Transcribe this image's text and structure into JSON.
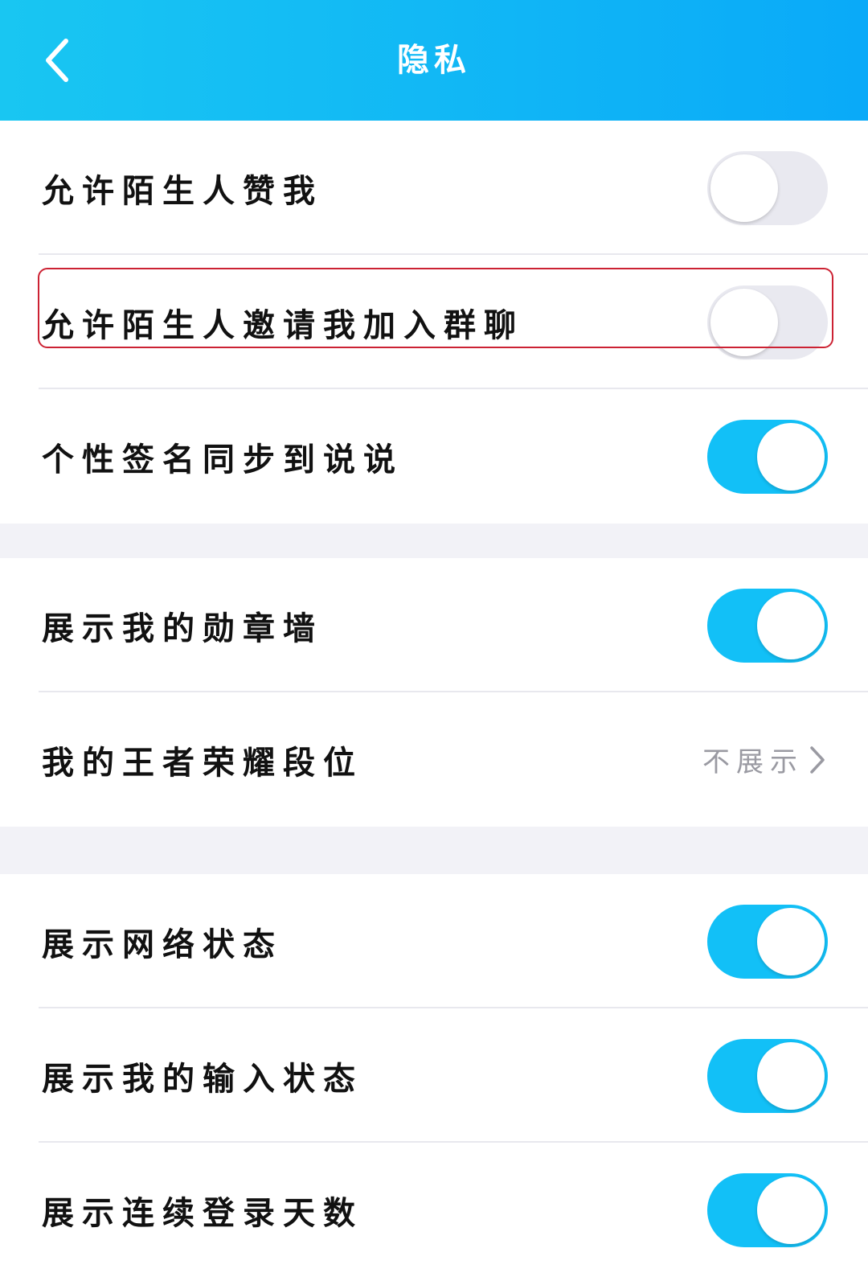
{
  "header": {
    "title": "隐私",
    "back_icon": "chevron-left-icon"
  },
  "colors": {
    "header_gradient_start": "#19c6f2",
    "header_gradient_end": "#0aaaf8",
    "toggle_on": "#12c0f7",
    "toggle_off": "#e9e9f0",
    "highlight": "#cc2233"
  },
  "sections": [
    {
      "rows": [
        {
          "label": "允许陌生人赞我",
          "toggle": false
        },
        {
          "label": "允许陌生人邀请我加入群聊",
          "toggle": false
        },
        {
          "label": "个性签名同步到说说",
          "toggle": true
        }
      ]
    },
    {
      "rows": [
        {
          "label": "展示我的勋章墙",
          "toggle": true
        },
        {
          "label": "我的王者荣耀段位",
          "value": "不展示",
          "chevron_icon": "chevron-right-icon"
        }
      ]
    },
    {
      "rows": [
        {
          "label": "展示网络状态",
          "toggle": true
        },
        {
          "label": "展示我的输入状态",
          "toggle": true
        },
        {
          "label": "展示连续登录天数",
          "toggle": true
        }
      ]
    }
  ]
}
